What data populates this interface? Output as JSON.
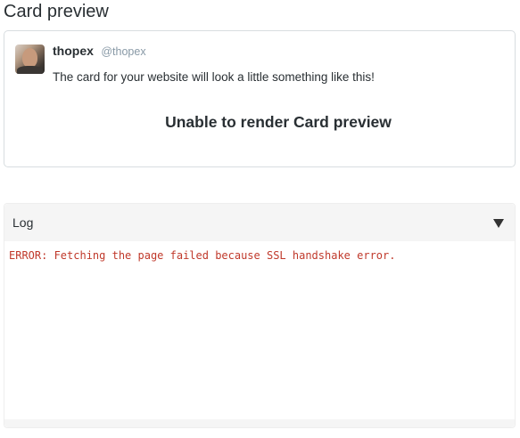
{
  "page": {
    "title": "Card preview"
  },
  "card": {
    "user_name": "thopex",
    "user_handle": "@thopex",
    "text": "The card for your website will look a little something like this!",
    "status": "Unable to render Card preview"
  },
  "log": {
    "title": "Log",
    "toggle_icon": "caret-down-icon",
    "lines": [
      "ERROR: Fetching the page failed because SSL handshake error."
    ]
  },
  "colors": {
    "error_text": "#c0392b",
    "header_bg": "#f5f5f5",
    "handle": "#8899a6"
  }
}
